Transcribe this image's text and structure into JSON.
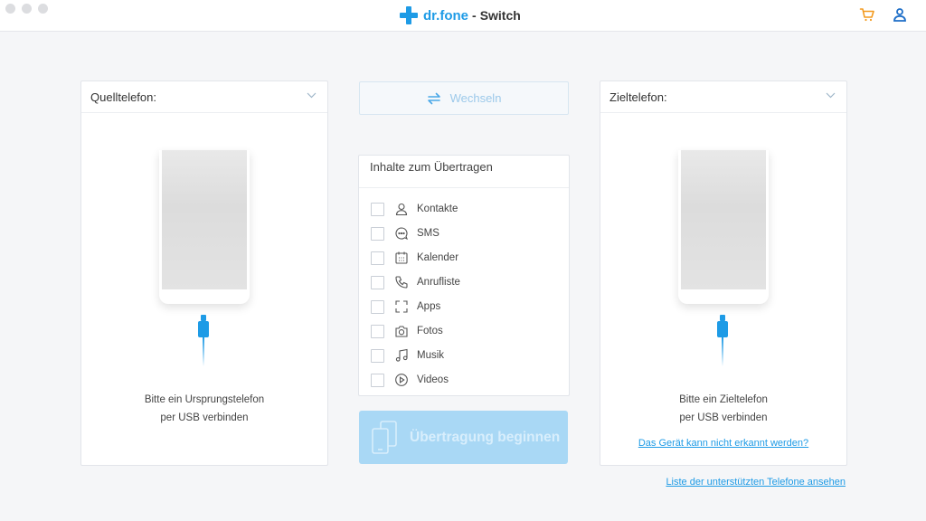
{
  "app": {
    "brand_name": "dr.fone",
    "brand_sep": "-",
    "product": "Switch",
    "brand_color": "#1e9be6",
    "cart_icon": "cart-icon",
    "account_icon": "user-icon"
  },
  "source": {
    "header": "Quelltelefon:",
    "hint_line1": "Bitte ein Ursprungstelefon",
    "hint_line2": "per USB verbinden"
  },
  "target": {
    "header": "Zieltelefon:",
    "hint_line1": "Bitte ein Zieltelefon",
    "hint_line2": "per USB verbinden",
    "help_link": "Das Gerät kann nicht erkannt werden?"
  },
  "switch_label": "Wechseln",
  "content": {
    "title": "Inhalte zum Übertragen",
    "items": [
      {
        "label": "Kontakte",
        "icon": "contact-icon",
        "checked": false
      },
      {
        "label": "SMS",
        "icon": "message-icon",
        "checked": false
      },
      {
        "label": "Kalender",
        "icon": "calendar-icon",
        "checked": false
      },
      {
        "label": "Anrufliste",
        "icon": "phone-icon",
        "checked": false
      },
      {
        "label": "Apps",
        "icon": "apps-icon",
        "checked": false
      },
      {
        "label": "Fotos",
        "icon": "camera-icon",
        "checked": false
      },
      {
        "label": "Musik",
        "icon": "music-icon",
        "checked": false
      },
      {
        "label": "Videos",
        "icon": "play-icon",
        "checked": false
      }
    ]
  },
  "start_label": "Übertragung beginnen",
  "supported_link": "Liste der unterstützten Telefone ansehen"
}
